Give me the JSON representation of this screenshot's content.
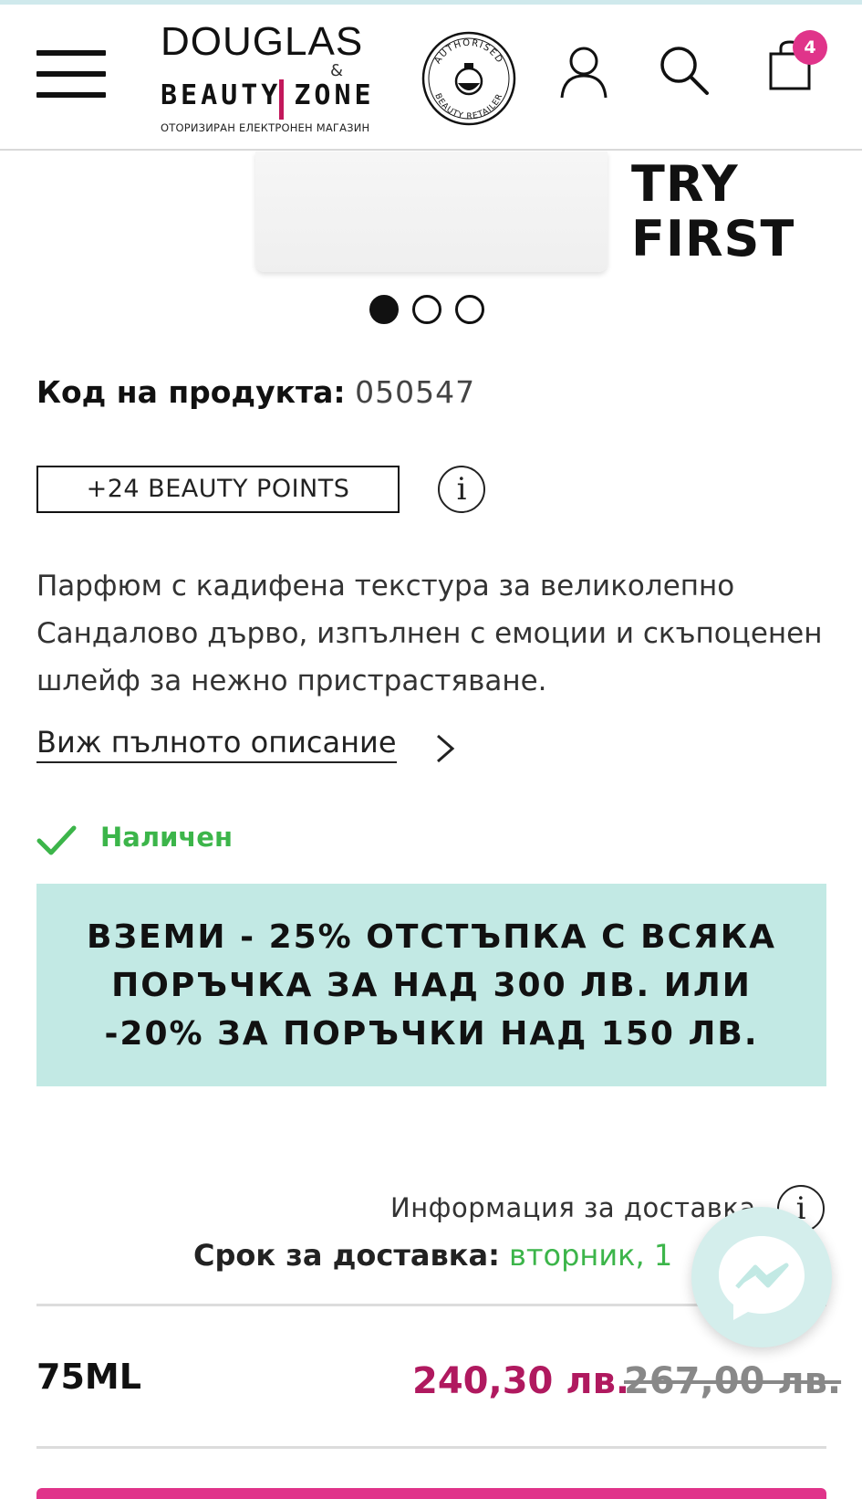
{
  "header": {
    "menu_icon": "hamburger-icon",
    "logo": {
      "line1": "DOUGLAS",
      "amp": "&",
      "line2_left": "BEAUTY",
      "line2_right": "ZONE",
      "tagline": "ОТОРИЗИРАН ЕЛЕКТРОНЕН МАГАЗИН"
    },
    "seal": {
      "top_text": "AUTHORISED",
      "bottom_text": "BEAUTY RETAILER"
    },
    "account_icon": "user-icon",
    "search_icon": "search-icon",
    "cart_icon": "shopping-bag-icon",
    "cart_count": "4"
  },
  "gallery": {
    "overlay_text_line1": "TRY",
    "overlay_text_line2": "FIRST",
    "dots_total": 3,
    "active_dot": 1
  },
  "product": {
    "code_label": "Код на продукта:",
    "code_value": "050547",
    "points_label": "+24 BEAUTY POINTS",
    "info_glyph": "i",
    "description": "Парфюм с кадифена текстура за великолепно Сандалово дърво, изпълнен с емоции и скъпоценен шлейф за нежно пристрастяване.",
    "more_link": "Виж пълното описание",
    "availability": "Наличен",
    "promo_text": "ВЗЕМИ - 25% ОТСТЪПКА С ВСЯКА ПОРЪЧКА ЗА НАД 300 ЛВ. ИЛИ -20% ЗА ПОРЪЧКИ НАД 150 ЛВ."
  },
  "delivery": {
    "info_label": "Информация за доставка",
    "term_label": "Срок за доставка:",
    "term_value": "вторник, 1"
  },
  "pricing": {
    "size": "75ML",
    "price_new": "240,30 лв.",
    "price_old": "267,00 лв."
  },
  "colors": {
    "accent_pink": "#e0348a",
    "price_magenta": "#b0195f",
    "success_green": "#3cb54a",
    "promo_bg": "#c2e9e4"
  },
  "floating": {
    "messenger_icon": "messenger-icon"
  }
}
